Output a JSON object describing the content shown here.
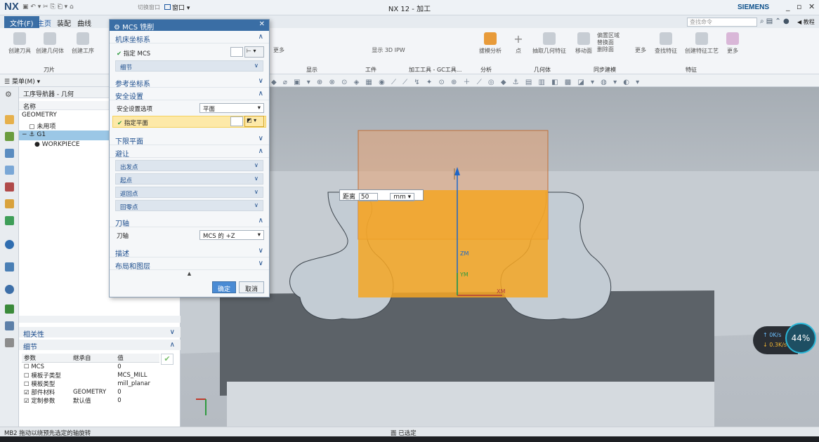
{
  "titlebar": {
    "logo": "NX",
    "quick_label": "切换窗口",
    "window_menu": "窗口",
    "title": "NX 12 - 加工",
    "brand": "SIEMENS"
  },
  "menu": {
    "tabs": [
      "文件(F)",
      "主页",
      "装配",
      "曲线"
    ],
    "search_placeholder": "查找命令",
    "help_label": "教程"
  },
  "ribbon": {
    "buttons": [
      "创建刀具",
      "创建几何体",
      "创建工序",
      "更多",
      "显示 3D IPW",
      "拔模分析",
      "点",
      "抽取几何特征",
      "移动面",
      "偏置区域",
      "替换面",
      "删除面",
      "更多",
      "查找特征",
      "创建特征工艺",
      "更多"
    ],
    "groups": [
      "刀片",
      "显示",
      "工件",
      "加工工具 - GC工具...",
      "分析",
      "几何体",
      "同步建模",
      "特征"
    ]
  },
  "cmdbar": {
    "menu_label": "菜单(M)"
  },
  "navigator": {
    "title": "工序导航器 - 几何",
    "column": "名称",
    "rows": [
      "GEOMETRY",
      "未用项",
      "G1",
      "WORKPIECE"
    ]
  },
  "relations": {
    "title": "相关性"
  },
  "details": {
    "title": "细节",
    "columns": [
      "参数",
      "继承自",
      "值"
    ],
    "rows": [
      {
        "param": "MCS",
        "from": "",
        "value": "0"
      },
      {
        "param": "模板子类型",
        "from": "",
        "value": "MCS_MILL"
      },
      {
        "param": "模板类型",
        "from": "",
        "value": "mill_planar"
      },
      {
        "param": "部件材料",
        "from": "GEOMETRY",
        "value": "0"
      },
      {
        "param": "定制参数",
        "from": "默认值",
        "value": "0"
      }
    ]
  },
  "dialog": {
    "title": "MCS 铣削",
    "machine_cs": "机床坐标系",
    "specify_mcs": "指定 MCS",
    "details": "细节",
    "ref_cs": "参考坐标系",
    "safety": "安全设置",
    "safety_option_label": "安全设置选项",
    "safety_option_value": "平面",
    "specify_plane": "指定平面",
    "lower_plane": "下限平面",
    "avoidance": "避让",
    "avoid_items": [
      "出发点",
      "起点",
      "返回点",
      "回零点"
    ],
    "tool_axis": "刀轴",
    "tool_axis_label": "刀轴",
    "tool_axis_value": "MCS 的 +Z",
    "description": "描述",
    "layout": "布局和图层",
    "ok": "确定",
    "cancel": "取消"
  },
  "distance": {
    "label": "距离",
    "value": "50",
    "unit": "mm"
  },
  "axes": {
    "zm": "ZM",
    "ym": "YM",
    "xm": "XM"
  },
  "status": {
    "left": "MB2 拖动以绕预先选定的轴旋转",
    "center": "面 已选定"
  },
  "speed": {
    "up": "0K/s",
    "down": "0.3K/s",
    "percent": "44%"
  },
  "colors": {
    "accent": "#3a6ea5",
    "plane": "#f5a623",
    "highlight": "#fde9a8"
  }
}
